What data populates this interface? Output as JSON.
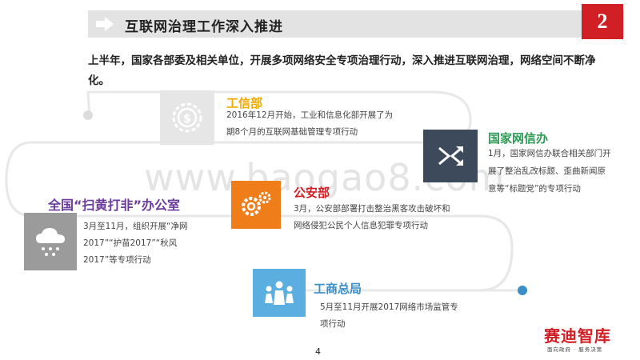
{
  "header": {
    "title": "互联网治理工作深入推进",
    "section_number": "2"
  },
  "intro": "上半年，国家各部委及相关单位，开展多项网络安全专项治理行动，深入推进互联网治理，网络空间不断净化。",
  "watermark": "www.baogao8.com",
  "sections": {
    "miit": {
      "title": "工信部",
      "text_1": "2016年12月开始，工业和信息化部开展了为",
      "text_2": "期8个月的互联网基础管理专项行动",
      "color": "#f2a900"
    },
    "cac": {
      "title": "国家网信办",
      "text_1": "1月，国家网信办联合相关部门开",
      "text_2": "展了整治乱改标题、歪曲新闻原",
      "text_3": "意等“标题党”的专项行动",
      "color": "#2e9a55"
    },
    "anti_porn": {
      "title": "全国“扫黄打非”办公室",
      "text_1": "3月至11月，组织开展“净网",
      "text_2": "2017”“护苗2017”“秋风",
      "text_3": "2017”等专项行动",
      "color": "#6b3b9c"
    },
    "police": {
      "title": "公安部",
      "text_1": "3月，公安部部署打击整治黑客攻击破坏和",
      "text_2": "网络侵犯公民个人信息犯罪专项行动",
      "color": "#d11f26"
    },
    "saic": {
      "title": "工商总局",
      "text_1": "5月至11月开展2017网络市场监管专",
      "text_2": "项行动",
      "color": "#3a8fc9"
    }
  },
  "icon_colors": {
    "miit_box": "#e6e6e6",
    "cac_box": "#3c4a5c",
    "anti_porn_box": "#9b9b9b",
    "police_box": "#ef7d1a",
    "saic_box": "#5aaee0"
  },
  "page_number": "4",
  "logo": {
    "name": "赛迪智库",
    "slogan": "面向政府 · 服务决策"
  }
}
